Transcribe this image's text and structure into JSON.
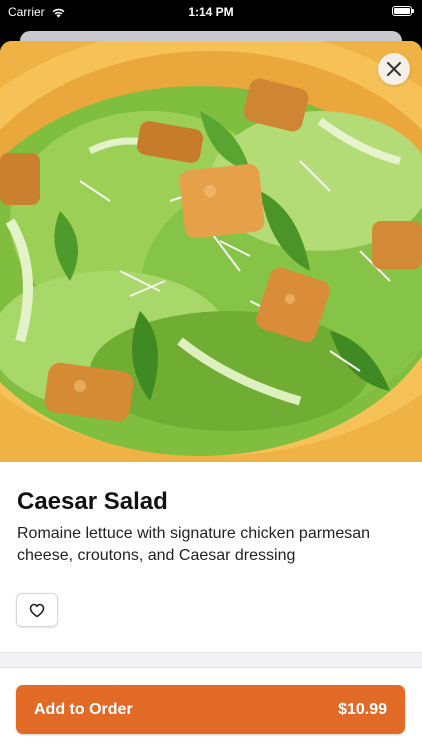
{
  "status_bar": {
    "carrier": "Carrier",
    "time": "1:14 PM",
    "wifi_icon": "wifi-icon",
    "battery_icon": "battery-icon"
  },
  "modal": {
    "close_icon": "close-icon"
  },
  "item": {
    "title": "Caesar Salad",
    "description": "Romaine lettuce with signature chicken parmesan cheese, croutons, and Caesar dressing",
    "favorite_icon": "heart-outline-icon"
  },
  "footer": {
    "add_label": "Add to Order",
    "price": "$10.99",
    "accent_color": "#e06a26"
  }
}
